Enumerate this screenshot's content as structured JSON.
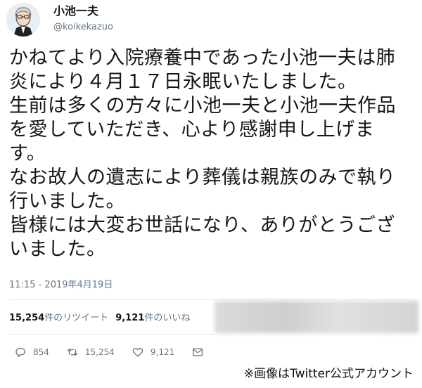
{
  "user": {
    "display_name": "小池一夫",
    "handle": "@koikekazuo",
    "avatar_icon": "avatar-illustration-icon"
  },
  "tweet": {
    "text": "かねてより入院療養中であった小池一夫は肺\n炎により４月１７日永眠いたしました。\n生前は多くの方々に小池一夫と小池一夫作品\nを愛していただき、心より感謝申し上げま\nす。\nなお故人の遺志により葬儀は親族のみで執り\n行いました。\n皆様には大変お世話になり、ありがとうござ\nいました。",
    "timestamp": "11:15 - 2019年4月19日"
  },
  "stats": {
    "retweets_count": "15,254",
    "retweets_label": "件のリツイート",
    "likes_count": "9,121",
    "likes_label": "件のいいね"
  },
  "actions": {
    "replies": "854",
    "retweets": "15,254",
    "likes": "9,121",
    "icons": [
      "reply-icon",
      "retweet-icon",
      "heart-icon",
      "message-icon"
    ]
  },
  "colors": {
    "text": "#14171a",
    "muted": "#657786",
    "divider": "#e6ecf0"
  },
  "caption": "※画像はTwitter公式アカウント"
}
